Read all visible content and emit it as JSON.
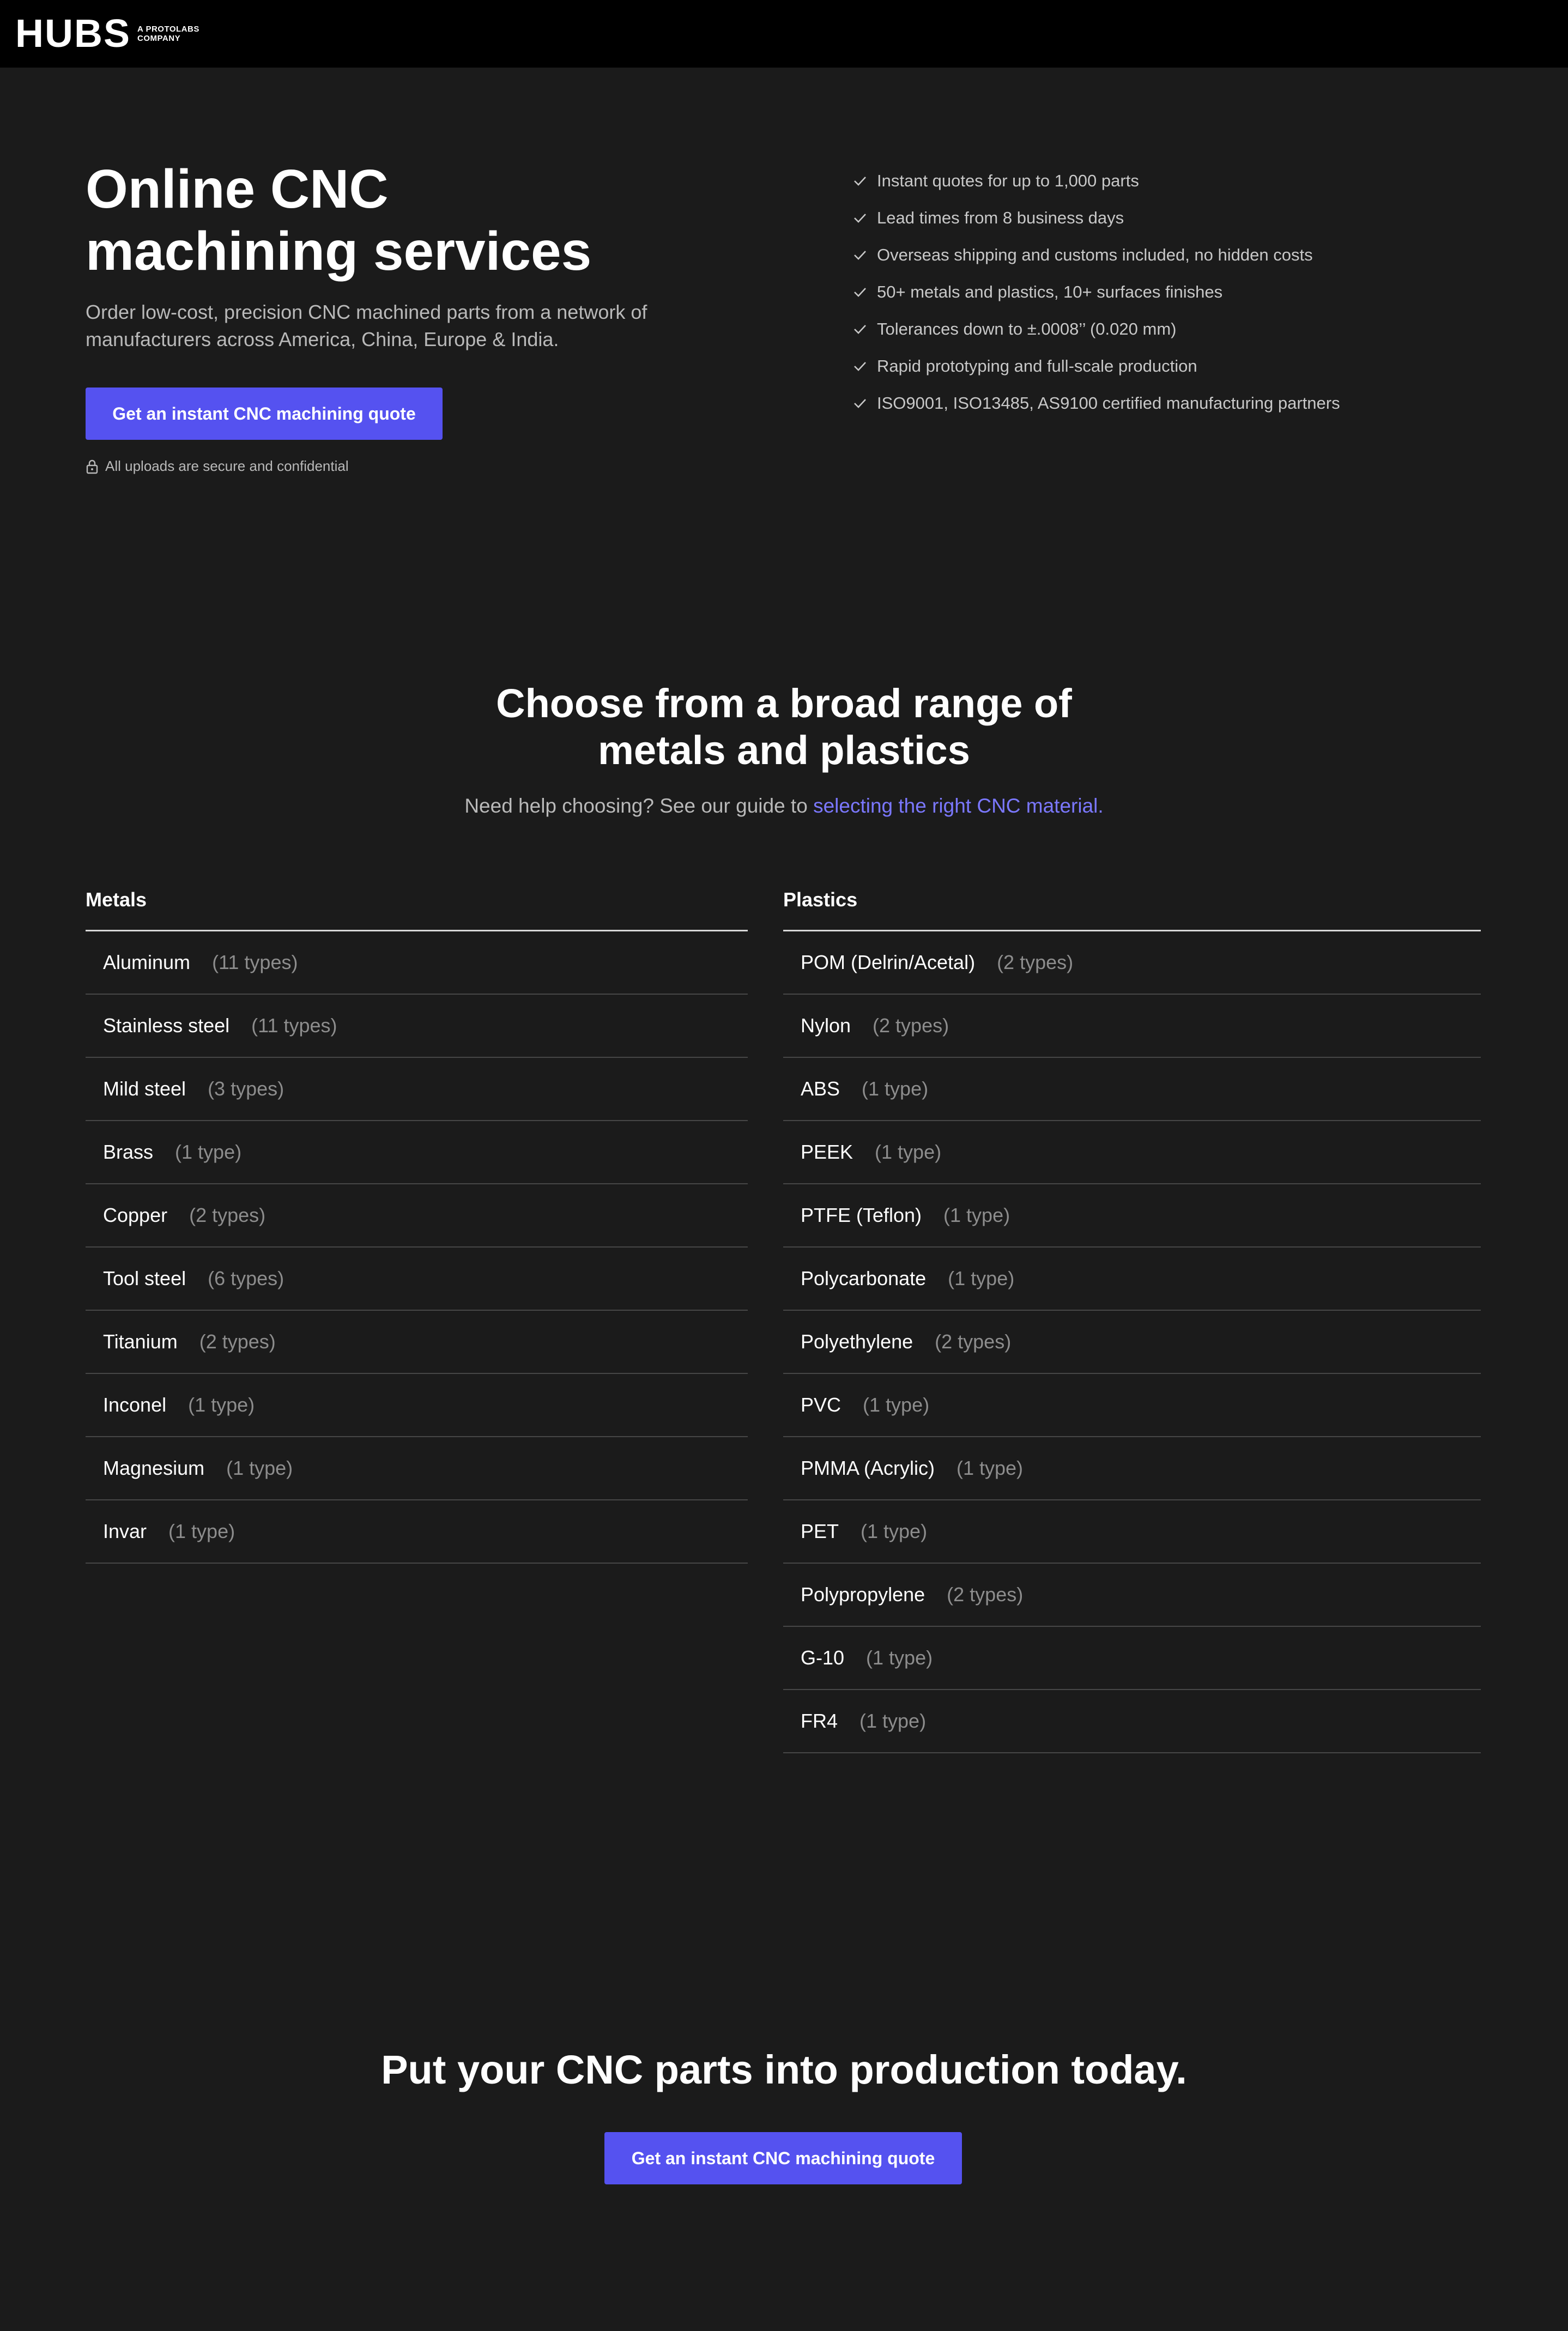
{
  "header": {
    "logo_text": "HUBS",
    "logo_sub_line1": "A PROTOLABS",
    "logo_sub_line2": "COMPANY"
  },
  "hero": {
    "title_line1": "Online CNC",
    "title_line2": "machining services",
    "subtitle": "Order low-cost, precision CNC machined parts from a network of manufacturers across America, China, Europe & India.",
    "cta_label": "Get an instant CNC machining quote",
    "secure_note": "All uploads are secure and confidential",
    "features": [
      "Instant quotes for up to 1,000 parts",
      "Lead times from 8 business days",
      "Overseas shipping and customs included, no hidden costs",
      "50+ metals and plastics, 10+ surfaces finishes",
      "Tolerances down to ±.0008’’ (0.020 mm)",
      "Rapid prototyping and full-scale production",
      "ISO9001, ISO13485, AS9100 certified manufacturing partners"
    ]
  },
  "materials": {
    "title_line1": "Choose from a broad range of",
    "title_line2": "metals and plastics",
    "help_text": "Need help choosing? See our guide to ",
    "help_link": "selecting the right CNC material.",
    "metals": {
      "heading": "Metals",
      "items": [
        {
          "name": "Aluminum",
          "count": "(11 types)"
        },
        {
          "name": "Stainless steel",
          "count": "(11 types)"
        },
        {
          "name": "Mild steel",
          "count": "(3 types)"
        },
        {
          "name": "Brass",
          "count": "(1 type)"
        },
        {
          "name": "Copper",
          "count": "(2 types)"
        },
        {
          "name": "Tool steel",
          "count": "(6 types)"
        },
        {
          "name": "Titanium",
          "count": "(2 types)"
        },
        {
          "name": "Inconel",
          "count": "(1 type)"
        },
        {
          "name": "Magnesium",
          "count": "(1 type)"
        },
        {
          "name": "Invar",
          "count": "(1 type)"
        }
      ]
    },
    "plastics": {
      "heading": "Plastics",
      "items": [
        {
          "name": "POM (Delrin/Acetal)",
          "count": "(2 types)"
        },
        {
          "name": "Nylon",
          "count": "(2 types)"
        },
        {
          "name": "ABS",
          "count": "(1 type)"
        },
        {
          "name": "PEEK",
          "count": "(1 type)"
        },
        {
          "name": "PTFE (Teflon)",
          "count": "(1 type)"
        },
        {
          "name": "Polycarbonate",
          "count": "(1 type)"
        },
        {
          "name": "Polyethylene",
          "count": "(2 types)"
        },
        {
          "name": "PVC",
          "count": "(1 type)"
        },
        {
          "name": "PMMA (Acrylic)",
          "count": "(1 type)"
        },
        {
          "name": "PET",
          "count": "(1 type)"
        },
        {
          "name": "Polypropylene",
          "count": "(2 types)"
        },
        {
          "name": "G-10",
          "count": "(1 type)"
        },
        {
          "name": "FR4",
          "count": "(1 type)"
        }
      ]
    }
  },
  "cta": {
    "title": "Put your CNC parts into production today.",
    "button_label": "Get an instant CNC machining quote"
  },
  "colors": {
    "background": "#1b1b1b",
    "topbar": "#000000",
    "accent": "#5552f0",
    "link": "#7b78ff"
  }
}
